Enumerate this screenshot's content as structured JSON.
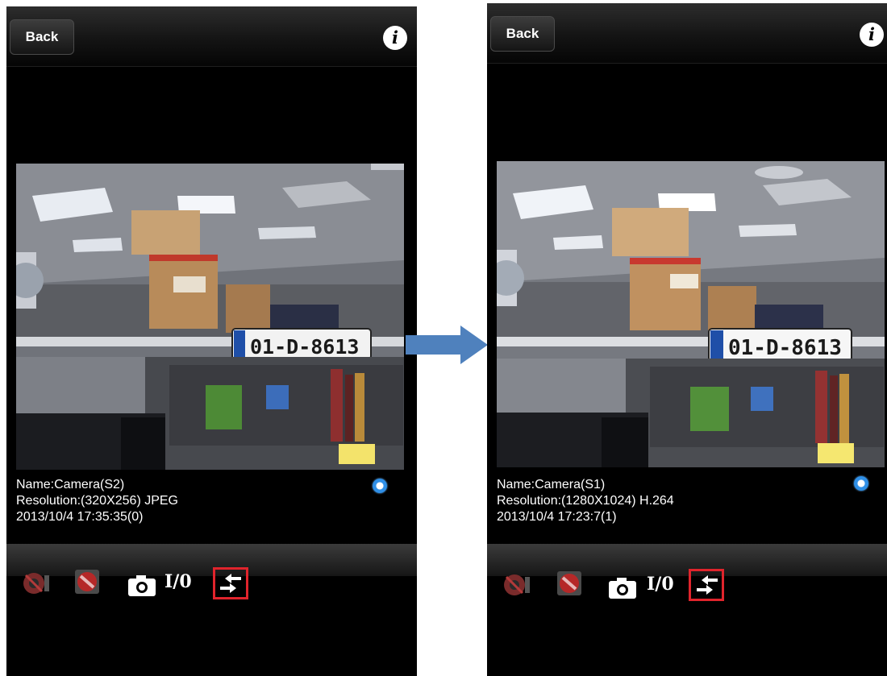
{
  "screens": [
    {
      "back_label": "Back",
      "info_label": "i",
      "name": "Name:Camera(S2)",
      "resolution": "Resolution:(320X256) JPEG",
      "timestamp": "2013/10/4 17:35:35(0)",
      "plate_text": "01-D-8613",
      "io_label": "I/0"
    },
    {
      "back_label": "Back",
      "info_label": "i",
      "name": "Name:Camera(S1)",
      "resolution": "Resolution:(1280X1024) H.264",
      "timestamp": "2013/10/4 17:23:7(1)",
      "plate_text": "01-D-8613",
      "io_label": "I/0"
    }
  ],
  "colors": {
    "highlight_box": "#e0242c",
    "transition_arrow": "#4f81bd",
    "status_dot": "#2f8fe6"
  },
  "icons": [
    "ptz-disabled-icon",
    "stop-disabled-icon",
    "camera-snapshot-icon",
    "swap-stream-icon",
    "info-icon",
    "right-arrow-icon"
  ]
}
